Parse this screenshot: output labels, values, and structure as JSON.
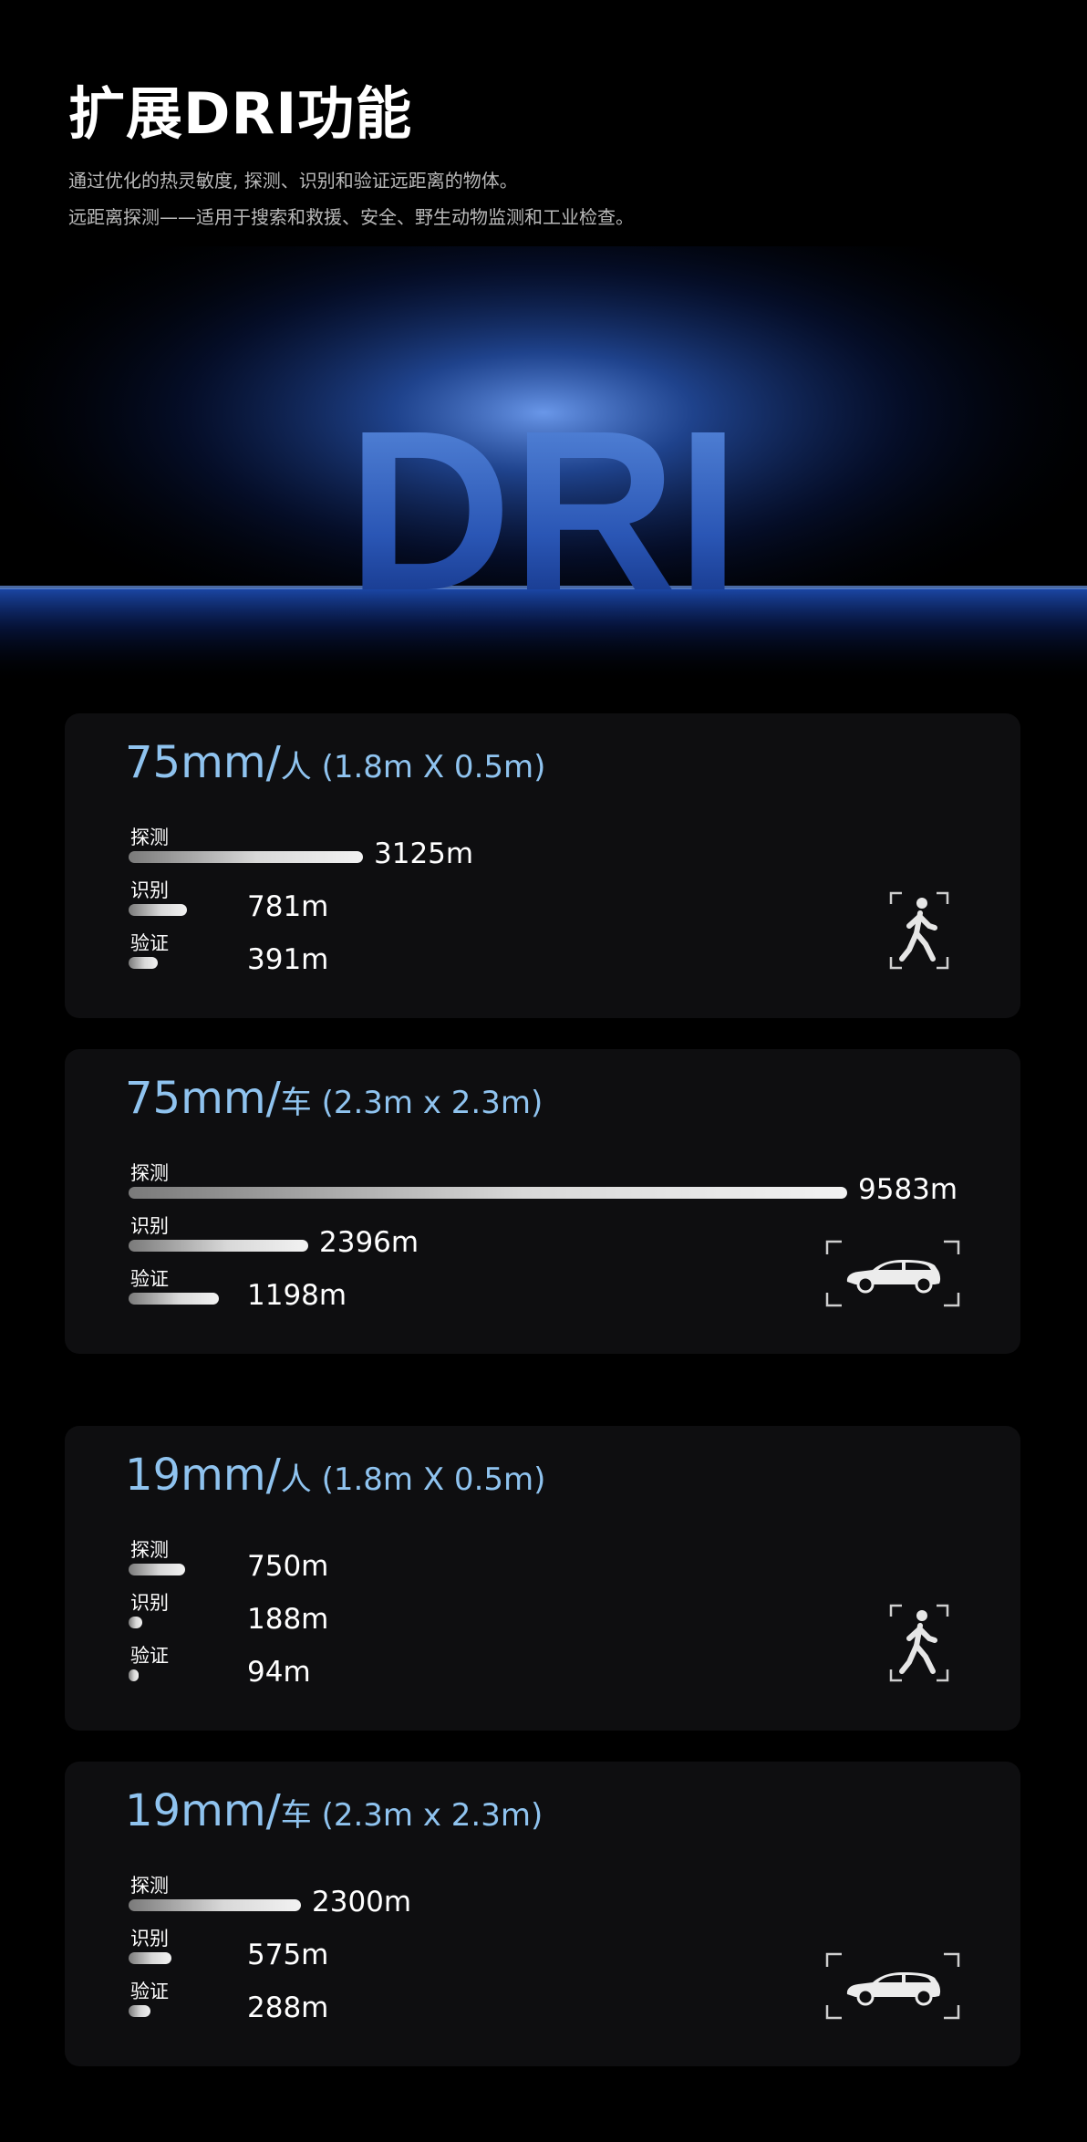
{
  "header": {
    "title": "扩展DRI功能",
    "subtitle_lines": [
      "通过优化的热灵敏度, 探测、识别和验证远距离的物体。",
      "远距离探测——适用于搜索和救援、安全、野生动物监测和工业检查。"
    ]
  },
  "hero": {
    "logo_text": "DRI"
  },
  "cards": [
    {
      "lens": "75mm/",
      "object": "人",
      "dims": " (1.8m X 0.5m)",
      "icon": "pedestrian-icon",
      "metrics": [
        {
          "label": "探测",
          "value": "3125m",
          "fraction": 0.3261
        },
        {
          "label": "识别",
          "value": "781m",
          "fraction": 0.0815
        },
        {
          "label": "验证",
          "value": "391m",
          "fraction": 0.0408
        }
      ]
    },
    {
      "lens": "75mm/",
      "object": "车",
      "dims": " (2.3m x 2.3m)",
      "icon": "car-icon",
      "metrics": [
        {
          "label": "探测",
          "value": "9583m",
          "fraction": 1.0
        },
        {
          "label": "识别",
          "value": "2396m",
          "fraction": 0.25
        },
        {
          "label": "验证",
          "value": "1198m",
          "fraction": 0.125
        }
      ]
    },
    {
      "lens": "19mm/",
      "object": "人",
      "dims": " (1.8m X 0.5m)",
      "icon": "pedestrian-icon",
      "metrics": [
        {
          "label": "探测",
          "value": "750m",
          "fraction": 0.0783
        },
        {
          "label": "识别",
          "value": "188m",
          "fraction": 0.0196
        },
        {
          "label": "验证",
          "value": "94m",
          "fraction": 0.0098
        }
      ]
    },
    {
      "lens": "19mm/",
      "object": "车",
      "dims": " (2.3m x 2.3m)",
      "icon": "car-icon",
      "metrics": [
        {
          "label": "探测",
          "value": "2300m",
          "fraction": 0.24
        },
        {
          "label": "识别",
          "value": "575m",
          "fraction": 0.06
        },
        {
          "label": "验证",
          "value": "288m",
          "fraction": 0.03
        }
      ]
    }
  ]
}
